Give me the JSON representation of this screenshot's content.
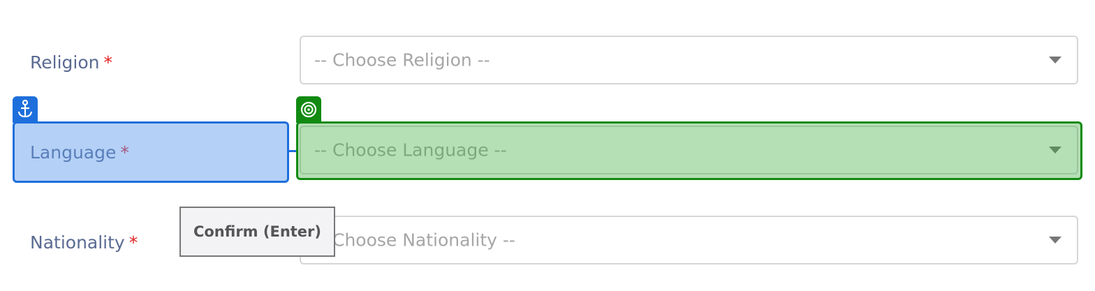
{
  "form": {
    "religion": {
      "label": "Religion",
      "required_mark": "*",
      "placeholder": "-- Choose Religion --"
    },
    "language": {
      "label": "Language",
      "required_mark": "*",
      "placeholder": "-- Choose Language --"
    },
    "nationality": {
      "label": "Nationality",
      "required_mark": "*",
      "placeholder": "-- Choose Nationality --"
    }
  },
  "overlay": {
    "anchor_icon": "anchor-icon",
    "target_icon": "target-icon",
    "tooltip_text": "Confirm (Enter)",
    "colors": {
      "anchor": "#1e6fdc",
      "target": "#128a12",
      "required": "#e02424",
      "label": "#5a6a92",
      "placeholder": "#a6a6a6"
    }
  }
}
